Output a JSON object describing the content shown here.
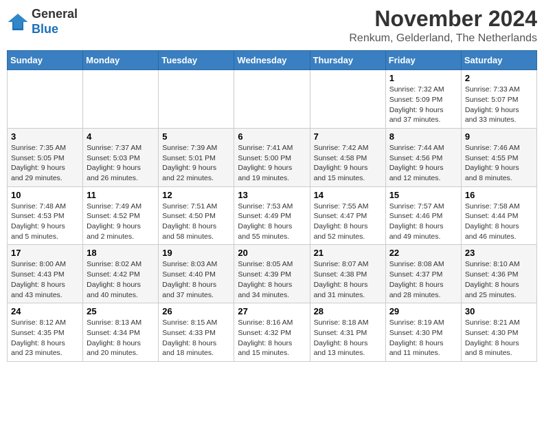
{
  "header": {
    "logo_general": "General",
    "logo_blue": "Blue",
    "month_title": "November 2024",
    "location": "Renkum, Gelderland, The Netherlands"
  },
  "weekdays": [
    "Sunday",
    "Monday",
    "Tuesday",
    "Wednesday",
    "Thursday",
    "Friday",
    "Saturday"
  ],
  "rows": [
    [
      {
        "day": "",
        "sunrise": "",
        "sunset": "",
        "daylight": ""
      },
      {
        "day": "",
        "sunrise": "",
        "sunset": "",
        "daylight": ""
      },
      {
        "day": "",
        "sunrise": "",
        "sunset": "",
        "daylight": ""
      },
      {
        "day": "",
        "sunrise": "",
        "sunset": "",
        "daylight": ""
      },
      {
        "day": "",
        "sunrise": "",
        "sunset": "",
        "daylight": ""
      },
      {
        "day": "1",
        "sunrise": "Sunrise: 7:32 AM",
        "sunset": "Sunset: 5:09 PM",
        "daylight": "Daylight: 9 hours and 37 minutes."
      },
      {
        "day": "2",
        "sunrise": "Sunrise: 7:33 AM",
        "sunset": "Sunset: 5:07 PM",
        "daylight": "Daylight: 9 hours and 33 minutes."
      }
    ],
    [
      {
        "day": "3",
        "sunrise": "Sunrise: 7:35 AM",
        "sunset": "Sunset: 5:05 PM",
        "daylight": "Daylight: 9 hours and 29 minutes."
      },
      {
        "day": "4",
        "sunrise": "Sunrise: 7:37 AM",
        "sunset": "Sunset: 5:03 PM",
        "daylight": "Daylight: 9 hours and 26 minutes."
      },
      {
        "day": "5",
        "sunrise": "Sunrise: 7:39 AM",
        "sunset": "Sunset: 5:01 PM",
        "daylight": "Daylight: 9 hours and 22 minutes."
      },
      {
        "day": "6",
        "sunrise": "Sunrise: 7:41 AM",
        "sunset": "Sunset: 5:00 PM",
        "daylight": "Daylight: 9 hours and 19 minutes."
      },
      {
        "day": "7",
        "sunrise": "Sunrise: 7:42 AM",
        "sunset": "Sunset: 4:58 PM",
        "daylight": "Daylight: 9 hours and 15 minutes."
      },
      {
        "day": "8",
        "sunrise": "Sunrise: 7:44 AM",
        "sunset": "Sunset: 4:56 PM",
        "daylight": "Daylight: 9 hours and 12 minutes."
      },
      {
        "day": "9",
        "sunrise": "Sunrise: 7:46 AM",
        "sunset": "Sunset: 4:55 PM",
        "daylight": "Daylight: 9 hours and 8 minutes."
      }
    ],
    [
      {
        "day": "10",
        "sunrise": "Sunrise: 7:48 AM",
        "sunset": "Sunset: 4:53 PM",
        "daylight": "Daylight: 9 hours and 5 minutes."
      },
      {
        "day": "11",
        "sunrise": "Sunrise: 7:49 AM",
        "sunset": "Sunset: 4:52 PM",
        "daylight": "Daylight: 9 hours and 2 minutes."
      },
      {
        "day": "12",
        "sunrise": "Sunrise: 7:51 AM",
        "sunset": "Sunset: 4:50 PM",
        "daylight": "Daylight: 8 hours and 58 minutes."
      },
      {
        "day": "13",
        "sunrise": "Sunrise: 7:53 AM",
        "sunset": "Sunset: 4:49 PM",
        "daylight": "Daylight: 8 hours and 55 minutes."
      },
      {
        "day": "14",
        "sunrise": "Sunrise: 7:55 AM",
        "sunset": "Sunset: 4:47 PM",
        "daylight": "Daylight: 8 hours and 52 minutes."
      },
      {
        "day": "15",
        "sunrise": "Sunrise: 7:57 AM",
        "sunset": "Sunset: 4:46 PM",
        "daylight": "Daylight: 8 hours and 49 minutes."
      },
      {
        "day": "16",
        "sunrise": "Sunrise: 7:58 AM",
        "sunset": "Sunset: 4:44 PM",
        "daylight": "Daylight: 8 hours and 46 minutes."
      }
    ],
    [
      {
        "day": "17",
        "sunrise": "Sunrise: 8:00 AM",
        "sunset": "Sunset: 4:43 PM",
        "daylight": "Daylight: 8 hours and 43 minutes."
      },
      {
        "day": "18",
        "sunrise": "Sunrise: 8:02 AM",
        "sunset": "Sunset: 4:42 PM",
        "daylight": "Daylight: 8 hours and 40 minutes."
      },
      {
        "day": "19",
        "sunrise": "Sunrise: 8:03 AM",
        "sunset": "Sunset: 4:40 PM",
        "daylight": "Daylight: 8 hours and 37 minutes."
      },
      {
        "day": "20",
        "sunrise": "Sunrise: 8:05 AM",
        "sunset": "Sunset: 4:39 PM",
        "daylight": "Daylight: 8 hours and 34 minutes."
      },
      {
        "day": "21",
        "sunrise": "Sunrise: 8:07 AM",
        "sunset": "Sunset: 4:38 PM",
        "daylight": "Daylight: 8 hours and 31 minutes."
      },
      {
        "day": "22",
        "sunrise": "Sunrise: 8:08 AM",
        "sunset": "Sunset: 4:37 PM",
        "daylight": "Daylight: 8 hours and 28 minutes."
      },
      {
        "day": "23",
        "sunrise": "Sunrise: 8:10 AM",
        "sunset": "Sunset: 4:36 PM",
        "daylight": "Daylight: 8 hours and 25 minutes."
      }
    ],
    [
      {
        "day": "24",
        "sunrise": "Sunrise: 8:12 AM",
        "sunset": "Sunset: 4:35 PM",
        "daylight": "Daylight: 8 hours and 23 minutes."
      },
      {
        "day": "25",
        "sunrise": "Sunrise: 8:13 AM",
        "sunset": "Sunset: 4:34 PM",
        "daylight": "Daylight: 8 hours and 20 minutes."
      },
      {
        "day": "26",
        "sunrise": "Sunrise: 8:15 AM",
        "sunset": "Sunset: 4:33 PM",
        "daylight": "Daylight: 8 hours and 18 minutes."
      },
      {
        "day": "27",
        "sunrise": "Sunrise: 8:16 AM",
        "sunset": "Sunset: 4:32 PM",
        "daylight": "Daylight: 8 hours and 15 minutes."
      },
      {
        "day": "28",
        "sunrise": "Sunrise: 8:18 AM",
        "sunset": "Sunset: 4:31 PM",
        "daylight": "Daylight: 8 hours and 13 minutes."
      },
      {
        "day": "29",
        "sunrise": "Sunrise: 8:19 AM",
        "sunset": "Sunset: 4:30 PM",
        "daylight": "Daylight: 8 hours and 11 minutes."
      },
      {
        "day": "30",
        "sunrise": "Sunrise: 8:21 AM",
        "sunset": "Sunset: 4:30 PM",
        "daylight": "Daylight: 8 hours and 8 minutes."
      }
    ]
  ]
}
